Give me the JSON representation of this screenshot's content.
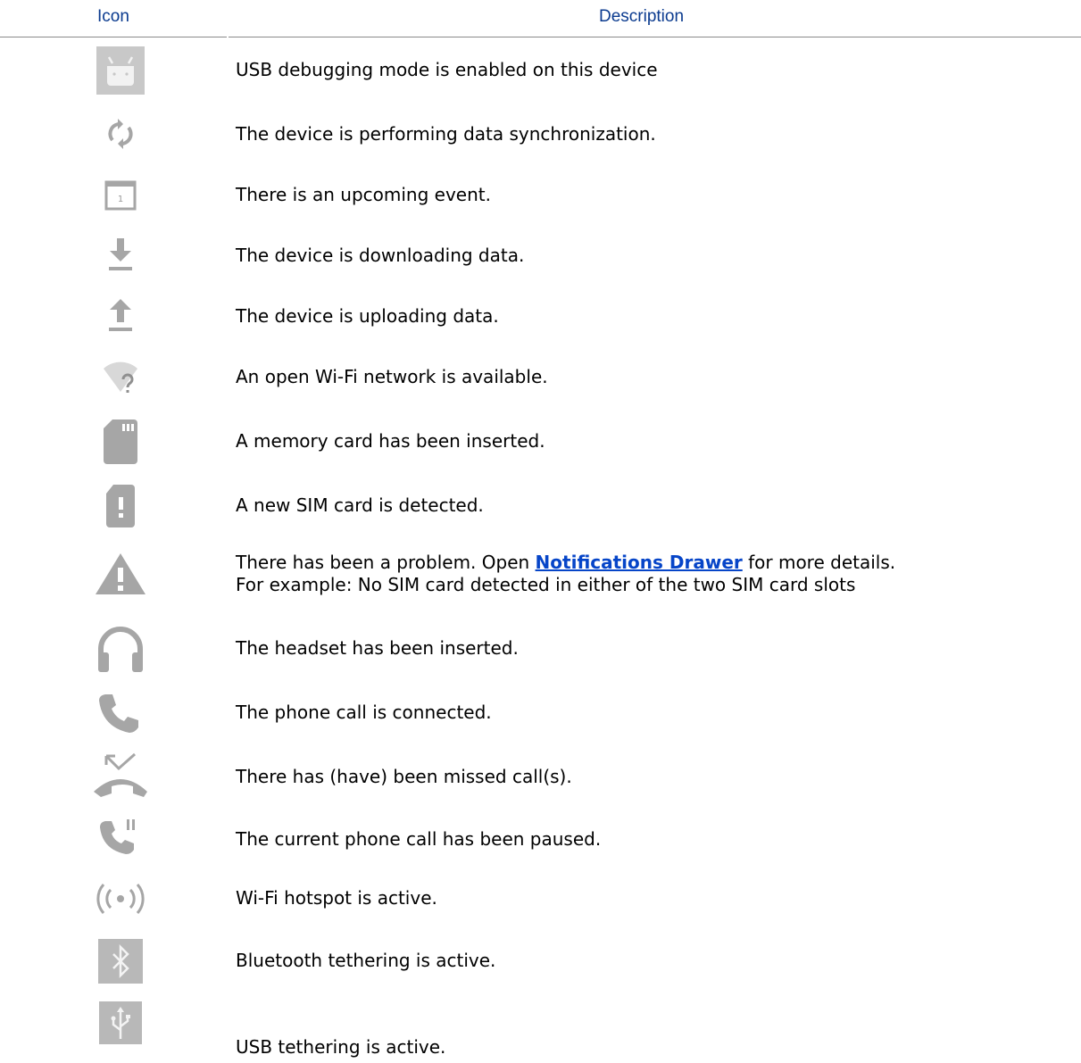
{
  "header": {
    "icon_col": "Icon",
    "desc_col": "Description"
  },
  "rows": [
    {
      "icon": "usb-debugging-icon",
      "text": "USB debugging mode is enabled on this device"
    },
    {
      "icon": "sync-icon",
      "text": "The device is performing data synchronization."
    },
    {
      "icon": "calendar-event-icon",
      "text": "There is an upcoming event."
    },
    {
      "icon": "download-icon",
      "text": "The device is downloading data."
    },
    {
      "icon": "upload-icon",
      "text": "The device is uploading data."
    },
    {
      "icon": "open-wifi-icon",
      "text": "An open Wi-Fi network is available."
    },
    {
      "icon": "memory-card-icon",
      "text": "A memory card has been inserted."
    },
    {
      "icon": "sim-card-alert-icon",
      "text": "A new SIM card is detected."
    },
    {
      "icon": "warning-icon",
      "text_before": "There has been a problem. Open ",
      "link": "Notifications Drawer",
      "text_after": " for more details.",
      "line2": "For example: No SIM card detected in either of the two SIM card slots"
    },
    {
      "icon": "headset-icon",
      "text": "The headset has been inserted."
    },
    {
      "icon": "phone-call-icon",
      "text": "The phone call is connected."
    },
    {
      "icon": "missed-call-icon",
      "text": "There has (have) been missed call(s)."
    },
    {
      "icon": "call-paused-icon",
      "text": "The current phone call has been paused."
    },
    {
      "icon": "wifi-hotspot-icon",
      "text": "Wi-Fi hotspot is active."
    },
    {
      "icon": "bluetooth-tethering-icon",
      "text": "Bluetooth tethering is active."
    },
    {
      "icon": "usb-tethering-icon",
      "text": "USB tethering is active."
    }
  ],
  "colors": {
    "header_text": "#0b3b8f",
    "link": "#0645c8",
    "icon_gray": "#a6a6a6"
  }
}
